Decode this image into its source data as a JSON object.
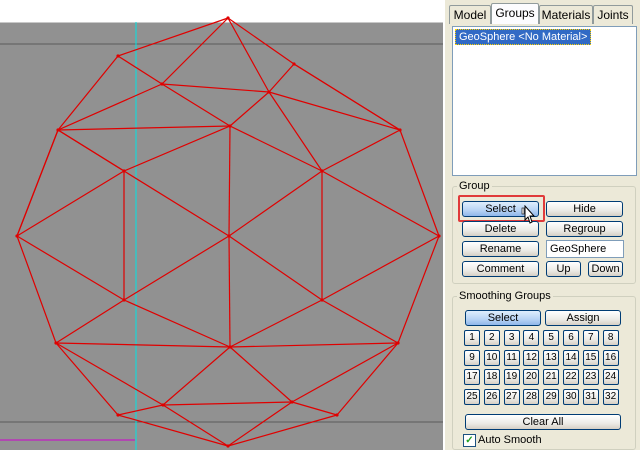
{
  "tabs": [
    {
      "label": "Model",
      "active": false
    },
    {
      "label": "Groups",
      "active": true
    },
    {
      "label": "Materials",
      "active": false
    },
    {
      "label": "Joints",
      "active": false
    }
  ],
  "groups_list": {
    "items": [
      "GeoSphere <No Material>"
    ],
    "selected_index": 0
  },
  "group_section": {
    "title": "Group",
    "select_label": "Select",
    "hide_label": "Hide",
    "delete_label": "Delete",
    "regroup_label": "Regroup",
    "rename_label": "Rename",
    "name_value": "GeoSphere",
    "comment_label": "Comment",
    "up_label": "Up",
    "down_label": "Down"
  },
  "smoothing_section": {
    "title": "Smoothing Groups",
    "select_label": "Select",
    "assign_label": "Assign",
    "numbers": [
      "1",
      "2",
      "3",
      "4",
      "5",
      "6",
      "7",
      "8",
      "9",
      "10",
      "11",
      "12",
      "13",
      "14",
      "15",
      "16",
      "17",
      "18",
      "19",
      "20",
      "21",
      "22",
      "23",
      "24",
      "25",
      "26",
      "27",
      "28",
      "29",
      "30",
      "31",
      "32"
    ],
    "clear_all_label": "Clear All",
    "auto_smooth_label": "Auto Smooth",
    "auto_smooth_checked": true
  },
  "colors": {
    "viewport_bg": "#919191",
    "wireframe": "#e00000",
    "cyan_line": "#00e5e5",
    "magenta_line": "#d000d0",
    "selection_highlight": "#e03a3a",
    "list_selection": "#316ac5"
  }
}
